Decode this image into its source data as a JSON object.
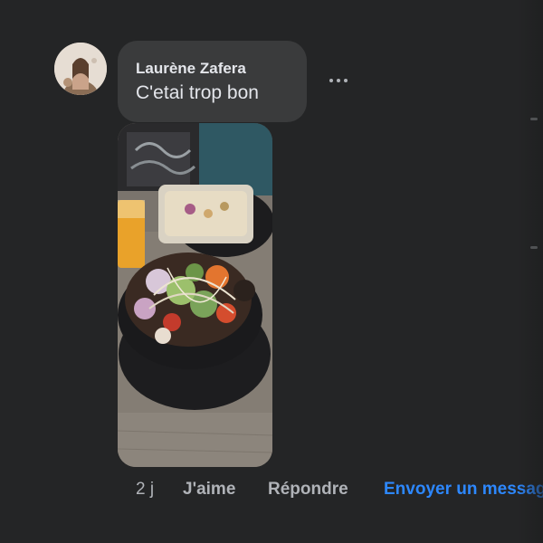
{
  "comment": {
    "author": "Laurène Zafera",
    "text": "C'etai trop bon",
    "avatar_icon": "profile-photo-avatar",
    "more_icon": "more-options-icon",
    "attachment_icon": "food-photo"
  },
  "actions": {
    "time": "2 j",
    "like": "J'aime",
    "reply": "Répondre",
    "send_message": "Envoyer un message"
  },
  "colors": {
    "background": "#242526",
    "bubble": "#3a3b3c",
    "text_primary": "#e4e6eb",
    "text_secondary": "#b0b3b8",
    "link_accent": "#2d88ff"
  }
}
